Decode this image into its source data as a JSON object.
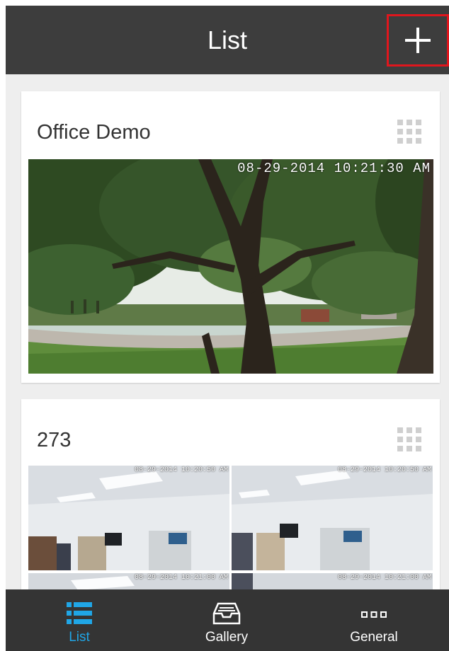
{
  "header": {
    "title": "List",
    "add_button_label": "+"
  },
  "cameras": [
    {
      "name": "Office Demo",
      "timestamp": "08-29-2014 10:21:30 AM"
    },
    {
      "name": "273",
      "timestamps": [
        "08-29-2014 10:20:50 AM",
        "08-29-2014 10:20:50 AM",
        "08-29-2014 10:21:00 AM",
        "08-29-2014 10:21:00 AM"
      ]
    }
  ],
  "tabs": [
    {
      "label": "List",
      "icon": "list-icon",
      "active": true
    },
    {
      "label": "Gallery",
      "icon": "gallery-tray-icon",
      "active": false
    },
    {
      "label": "General",
      "icon": "more-dots-icon",
      "active": false
    }
  ],
  "colors": {
    "accent": "#20a6e6",
    "bar": "#3d3d3d",
    "highlight": "#e0161d"
  }
}
